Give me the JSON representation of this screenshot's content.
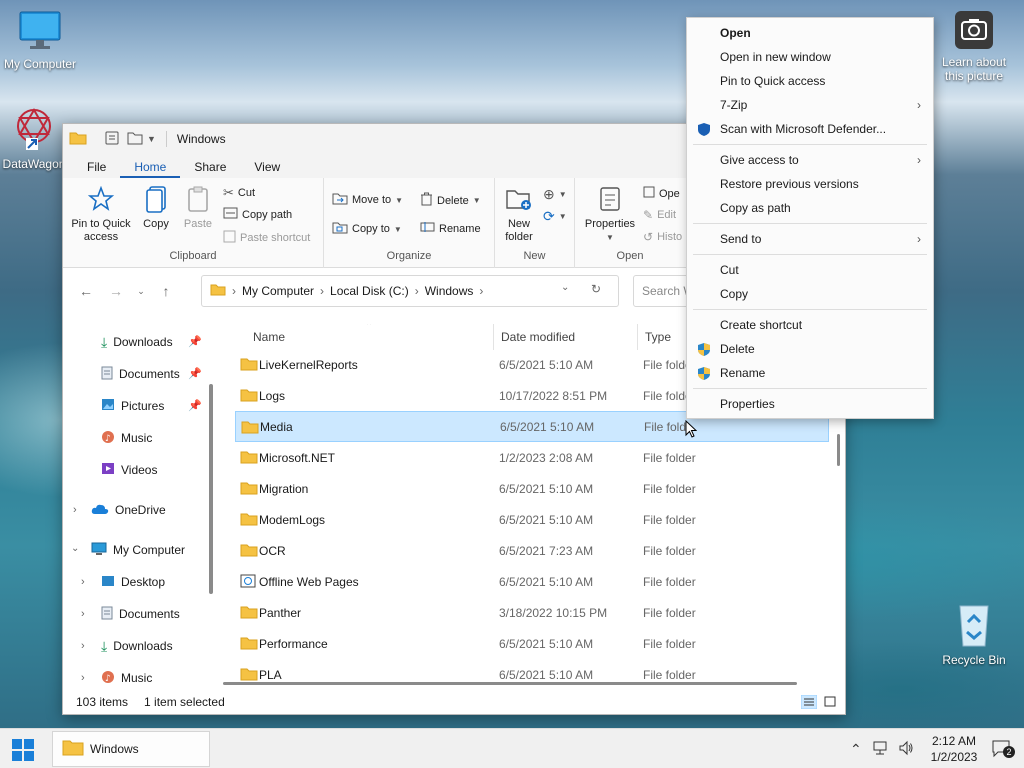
{
  "desktop": {
    "icons": [
      {
        "label": "My Computer"
      },
      {
        "label": "DataWagon"
      },
      {
        "label": "Learn about this picture"
      },
      {
        "label": "Recycle Bin"
      }
    ]
  },
  "window": {
    "title": "Windows",
    "tabs": [
      "File",
      "Home",
      "Share",
      "View"
    ],
    "active_tab": "Home"
  },
  "ribbon": {
    "clipboard": {
      "label": "Clipboard",
      "pin_quick_access": "Pin to Quick access",
      "copy": "Copy",
      "paste": "Paste",
      "cut": "Cut",
      "copy_path": "Copy path",
      "paste_shortcut": "Paste shortcut"
    },
    "organize": {
      "label": "Organize",
      "move_to": "Move to",
      "copy_to": "Copy to",
      "delete": "Delete",
      "rename": "Rename"
    },
    "new": {
      "label": "New",
      "new_folder": "New folder"
    },
    "open": {
      "label": "Open",
      "properties": "Properties",
      "open_cut": "Ope",
      "edit": "Edit",
      "history": "Histo"
    }
  },
  "address": {
    "crumbs": [
      "My Computer",
      "Local Disk (C:)",
      "Windows"
    ],
    "search_placeholder": "Search W"
  },
  "navpane": {
    "quick": [
      {
        "label": "Downloads",
        "icon": "download-icon"
      },
      {
        "label": "Documents",
        "icon": "documents-icon"
      },
      {
        "label": "Pictures",
        "icon": "pictures-icon"
      },
      {
        "label": "Music",
        "icon": "music-icon"
      },
      {
        "label": "Videos",
        "icon": "videos-icon"
      }
    ],
    "onedrive": "OneDrive",
    "my_computer": "My Computer",
    "computer_children": [
      {
        "label": "Desktop",
        "icon": "desktop-icon"
      },
      {
        "label": "Documents",
        "icon": "documents-icon"
      },
      {
        "label": "Downloads",
        "icon": "download-icon"
      },
      {
        "label": "Music",
        "icon": "music-icon"
      }
    ]
  },
  "files": {
    "columns": {
      "name": "Name",
      "date": "Date modified",
      "type": "Type"
    },
    "rows": [
      {
        "name": "LiveKernelReports",
        "date": "6/5/2021 5:10 AM",
        "type": "File folder"
      },
      {
        "name": "Logs",
        "date": "10/17/2022 8:51 PM",
        "type": "File folder"
      },
      {
        "name": "Media",
        "date": "6/5/2021 5:10 AM",
        "type": "File fold",
        "selected": true
      },
      {
        "name": "Microsoft.NET",
        "date": "1/2/2023 2:08 AM",
        "type": "File folder"
      },
      {
        "name": "Migration",
        "date": "6/5/2021 5:10 AM",
        "type": "File folder"
      },
      {
        "name": "ModemLogs",
        "date": "6/5/2021 5:10 AM",
        "type": "File folder"
      },
      {
        "name": "OCR",
        "date": "6/5/2021 7:23 AM",
        "type": "File folder"
      },
      {
        "name": "Offline Web Pages",
        "date": "6/5/2021 5:10 AM",
        "type": "File folder"
      },
      {
        "name": "Panther",
        "date": "3/18/2022 10:15 PM",
        "type": "File folder"
      },
      {
        "name": "Performance",
        "date": "6/5/2021 5:10 AM",
        "type": "File folder"
      },
      {
        "name": "PLA",
        "date": "6/5/2021 5:10 AM",
        "type": "File folder"
      }
    ]
  },
  "status": {
    "count": "103 items",
    "selection": "1 item selected"
  },
  "context_menu": {
    "items": [
      {
        "label": "Open",
        "bold": true
      },
      {
        "label": "Open in new window"
      },
      {
        "label": "Pin to Quick access"
      },
      {
        "label": "7-Zip",
        "submenu": true
      },
      {
        "label": "Scan with Microsoft Defender...",
        "icon": "defender-shield-icon"
      },
      {
        "label": "Give access to",
        "submenu": true
      },
      {
        "label": "Restore previous versions"
      },
      {
        "label": "Copy as path"
      },
      {
        "label": "Send to",
        "submenu": true
      },
      {
        "label": "Cut"
      },
      {
        "label": "Copy"
      },
      {
        "label": "Create shortcut"
      },
      {
        "label": "Delete",
        "icon": "uac-shield-icon"
      },
      {
        "label": "Rename",
        "icon": "uac-shield-icon"
      },
      {
        "label": "Properties"
      }
    ]
  },
  "taskbar": {
    "app_label": "Windows",
    "time": "2:12 AM",
    "date": "1/2/2023",
    "notification_count": "2"
  },
  "colors": {
    "accent": "#1a5fb4",
    "selection": "#cce8ff",
    "folder": "#f5c243"
  }
}
